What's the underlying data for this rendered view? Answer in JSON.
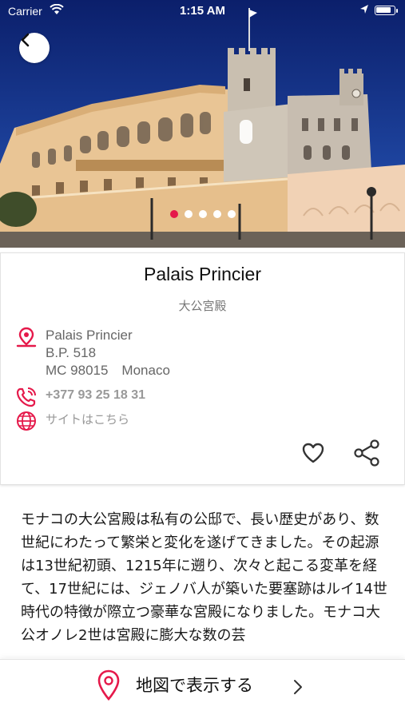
{
  "status_bar": {
    "carrier": "Carrier",
    "time": "1:15 AM",
    "battery_level": 0.85,
    "icons": [
      "wifi-icon",
      "location-arrow-icon",
      "battery-icon"
    ]
  },
  "hero": {
    "image_count": 5,
    "active_index": 0,
    "back_icon": "chevron-left-icon"
  },
  "place": {
    "name": "Palais Princier",
    "name_ja": "大公宮殿",
    "address": {
      "line1": "Palais Princier",
      "line2": "B.P. 518",
      "line3": "MC 98015　Monaco"
    },
    "phone": "+377 93 25 18 31",
    "website": "サイトはこちら",
    "icons": [
      "map-pin-icon",
      "phone-icon",
      "globe-icon",
      "heart-icon",
      "share-icon"
    ]
  },
  "description": {
    "text": "モナコの大公宮殿は私有の公邸で、長い歴史があり、数世紀にわたって繁栄と変化を遂げてきました。その起源は13世紀初頭、1215年に遡り、次々と起こる変革を経て、17世紀には、ジェノバ人が築いた要塞跡はルイ14世時代の特徴が際立つ豪華な宮殿になりました。モナコ大公オノレ2世は宮殿に膨大な数の芸"
  },
  "map_bar": {
    "label": "地図で表示する",
    "icons": [
      "map-pin-icon",
      "chevron-right-icon"
    ]
  },
  "colors": {
    "accent": "#e5194a",
    "sky": "#0e2a7a",
    "facade": "#e8c99a"
  }
}
